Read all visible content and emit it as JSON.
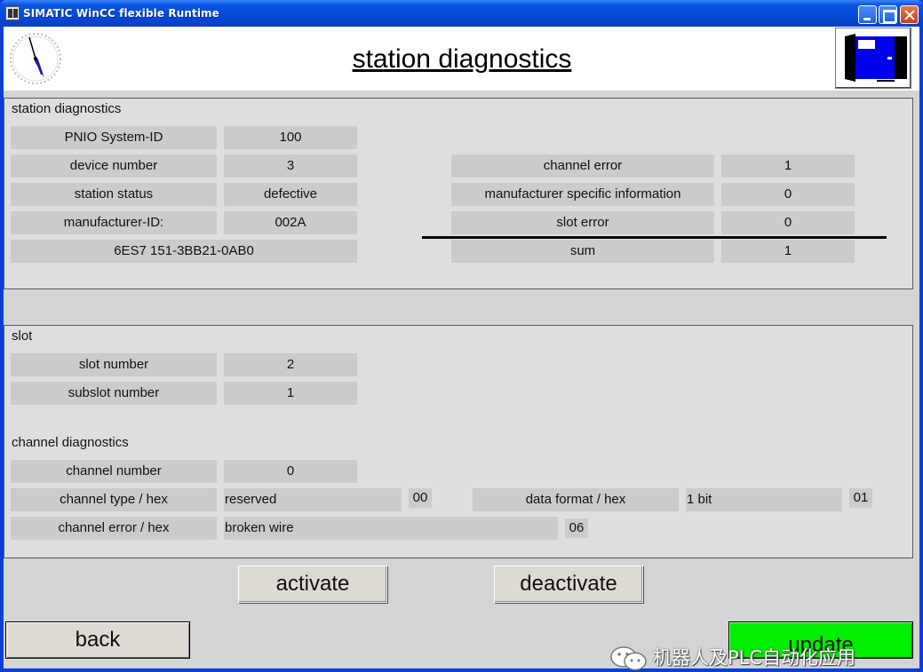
{
  "window": {
    "title": "SIMATIC WinCC flexible Runtime"
  },
  "header": {
    "title": "station diagnostics"
  },
  "station": {
    "section_label": "station diagnostics",
    "left_rows": [
      {
        "label": "PNIO System-ID",
        "value": "100"
      },
      {
        "label": "device number",
        "value": "3"
      },
      {
        "label": "station status",
        "value": "defective"
      },
      {
        "label": "manufacturer-ID:",
        "value": "002A"
      }
    ],
    "order_number": "6ES7 151-3BB21-0AB0",
    "right_rows": [
      {
        "label": "channel error",
        "value": "1"
      },
      {
        "label": "manufacturer specific information",
        "value": "0"
      },
      {
        "label": "slot error",
        "value": "0"
      },
      {
        "label": "sum",
        "value": "1"
      }
    ]
  },
  "slot": {
    "section_label": "slot",
    "rows": [
      {
        "label": "slot number",
        "value": "2"
      },
      {
        "label": "subslot number",
        "value": "1"
      }
    ]
  },
  "channel": {
    "section_label": "channel diagnostics",
    "number": {
      "label": "channel number",
      "value": "0"
    },
    "type": {
      "label": "channel type / hex",
      "value": "reserved",
      "hex": "00"
    },
    "data_format": {
      "label": "data format / hex",
      "value": "1 bit",
      "hex": "01"
    },
    "error": {
      "label": "channel error / hex",
      "value": "broken wire",
      "hex": "06"
    }
  },
  "buttons": {
    "activate": "activate",
    "deactivate": "deactivate",
    "back": "back",
    "update": "update"
  },
  "watermark": {
    "text": "机器人及PLC自动化应用"
  },
  "colors": {
    "titlebar": "#0a55e3",
    "panel_bg": "#dedede",
    "cell_bg": "#cbcbcb",
    "update_button": "#00ee00",
    "exit_icon": "#0000ee"
  }
}
